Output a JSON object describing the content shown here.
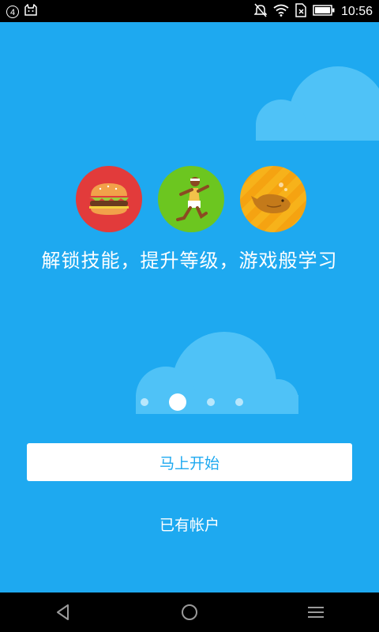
{
  "status_bar": {
    "notification_count": "4",
    "time": "10:56",
    "left_icons": [
      "notification-count-icon",
      "cat-app-icon"
    ],
    "right_icons": [
      "mute-icon",
      "wifi-icon",
      "sim-card-icon",
      "battery-icon"
    ]
  },
  "onboarding": {
    "badges": [
      {
        "icon": "burger-icon",
        "color": "#e23b3b"
      },
      {
        "icon": "runner-icon",
        "color": "#6cc620"
      },
      {
        "icon": "whale-icon",
        "color": "#f7b21a"
      }
    ],
    "tagline": "解锁技能，提升等级，游戏般学习",
    "page_indicator": {
      "total": 4,
      "active": 2
    }
  },
  "actions": {
    "start_button": "马上开始",
    "login_link": "已有帐户"
  },
  "nav_bar": {
    "buttons": [
      "back-icon",
      "home-icon",
      "menu-icon"
    ]
  },
  "colors": {
    "background": "#1ea9f0",
    "button_text": "#1ea9f0",
    "cloud": "#4fc2f7"
  }
}
